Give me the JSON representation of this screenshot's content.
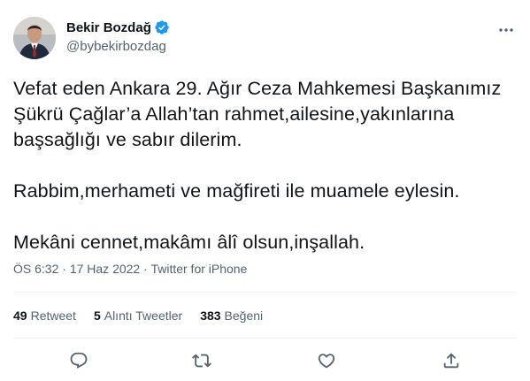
{
  "author": {
    "display_name": "Bekir Bozdağ",
    "handle": "@bybekirbozdag",
    "verified": true,
    "avatar_icon": "profile-photo"
  },
  "tweet": {
    "paragraphs": [
      "Vefat eden Ankara 29. Ağır Ceza Mahkemesi Başkanımız Şükrü Çağlar’a Allah’tan rahmet,ailesine,yakınlarına başsağlığı ve sabır dilerim.",
      "Rabbim,merhameti ve mağfireti ile muamele eylesin.",
      "Mekâni cennet,makâmı âlî olsun,inşallah."
    ],
    "time": "ÖS 6:32",
    "separator": "·",
    "date": "17 Haz 2022",
    "source": "Twitter for iPhone"
  },
  "stats": {
    "retweets_count": "49",
    "retweets_label": "Retweet",
    "quotes_count": "5",
    "quotes_label": "Alıntı Tweetler",
    "likes_count": "383",
    "likes_label": "Beğeni"
  },
  "icons": {
    "more": "more-dots-icon",
    "reply": "reply-icon",
    "retweet": "retweet-icon",
    "like": "heart-icon",
    "share": "share-icon"
  },
  "colors": {
    "text": "#0f1419",
    "secondary": "#536471",
    "verified": "#1d9bf0",
    "divider": "#eff3f4"
  }
}
